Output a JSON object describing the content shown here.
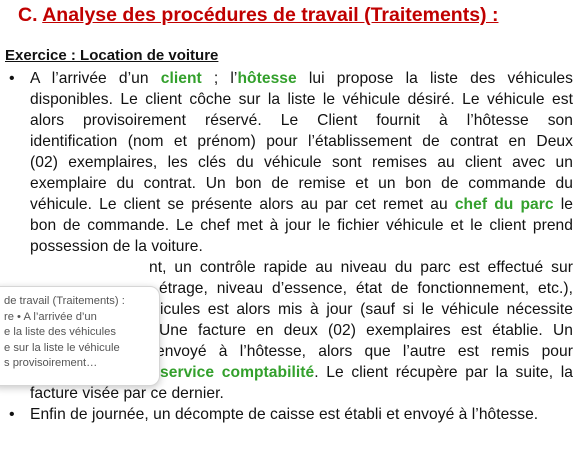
{
  "heading": {
    "prefix": "C.",
    "text": "Analyse des procédures de travail (Traitements) :"
  },
  "exercise_title": "Exercice : Location de voiture",
  "colors": {
    "heading": "#c00000",
    "highlight": "#33a02c"
  },
  "bullet_glyph": "•",
  "paragraph1": {
    "l1a": "A l’arrivée d’un ",
    "l1b": "client",
    "l1c": " ; l’",
    "l1d": "hôtesse",
    "l1e": " lui propose la liste des véhicules",
    "l2": "disponibles. Le client côche sur la liste le véhicule désiré. Le véhicule est",
    "l3": "alors provisoirement réservé. Le Client fournit à l’hôtesse son",
    "l4": "identification (nom et prénom) pour l’établissement de contrat en Deux",
    "l5": "(02) exemplaires, les clés du véhicule sont remises au client avec un",
    "l6": "exemplaire du contrat. Un bon de remise et un bon de commande du",
    "l7a": "véhicule. Le client se présente alors au par cet remet au ",
    "l7b": "chef du parc",
    "l7c": " le",
    "l8": "bon de commande. Le chef met à jour le fichier véhicule et le client prend",
    "l9": "possession de la voiture."
  },
  "paragraph2": {
    "l1": "nt, un contrôle rapide au niveau du parc est effectué sur",
    "l2": "étrage, niveau d’essence, état de fonctionnement, etc.),",
    "l3": "icules est alors mis à jour (sauf si le véhicule nécessite",
    "l4": "Une facture en deux (02) exemplaires est établie. Un",
    "l5": "envoyé à l’hôtesse, alors que l’autre est remis pour",
    "l6a": "service comptabilité",
    "l6b": ". Le client récupère par la suite, la",
    "l7": "facture visée par ce dernier."
  },
  "paragraph3": {
    "l1": "Enfin de journée, un décompte de caisse est établi et envoyé à l’hôtesse."
  },
  "tooltip": {
    "lines": [
      "de travail (Traitements) :",
      "re • A l’arrivée d’un",
      "e la liste des véhicules",
      "e sur la liste le véhicule",
      "s provisoirement…"
    ]
  }
}
